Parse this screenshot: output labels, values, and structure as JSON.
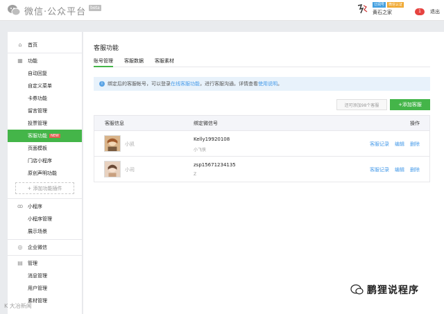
{
  "header": {
    "logo_text": "微信·公众平台",
    "beta": "beta",
    "badge_blue": "订阅号",
    "badge_orange": "微信认证",
    "username": "黄石之家",
    "notice_count": "1",
    "logout": "退出"
  },
  "sidebar": {
    "home": "首页",
    "function_section": "功能",
    "function_items": [
      "自动回复",
      "自定义菜单",
      "卡券功能",
      "留言管理",
      "投票管理"
    ],
    "active_item": "客服功能",
    "new_badge": "NEW",
    "function_items_after": [
      "页面模板",
      "门店小程序",
      "原创声明功能"
    ],
    "add_plugin": "+ 添加功能插件",
    "miniprogram_section": "小程序",
    "miniprogram_items": [
      "小程序管理",
      "展示场景"
    ],
    "enterprise_section": "企业微信",
    "manage_section": "管理",
    "manage_items": [
      "消息管理",
      "用户管理",
      "素材管理"
    ]
  },
  "main": {
    "title": "客服功能",
    "tabs": [
      "账号管理",
      "客服数据",
      "客服素材"
    ],
    "tip": {
      "before": "绑定后的客服帐号，可以登录",
      "link1": "在线客服功能",
      "middle": "，进行客服沟通。详情查看",
      "link2": "使用说明",
      "after": "。"
    },
    "quota_text": "还可添加98个客服",
    "add_button": "+添加客服",
    "table": {
      "headers": {
        "info": "客服信息",
        "wechat": "绑定微信号",
        "ops": "操作"
      },
      "rows": [
        {
          "name": "小凯",
          "wechat_id": "Kelly19920108",
          "nickname": "小飞侠",
          "ops": [
            "客服记录",
            "编辑",
            "删除"
          ]
        },
        {
          "name": "小司",
          "wechat_id": "zsp15671234135",
          "nickname": "Z",
          "ops": [
            "客服记录",
            "编辑",
            "删除"
          ]
        }
      ]
    }
  },
  "watermarks": {
    "left": "K 大冶新闻",
    "right": "鹏狸说程序"
  }
}
